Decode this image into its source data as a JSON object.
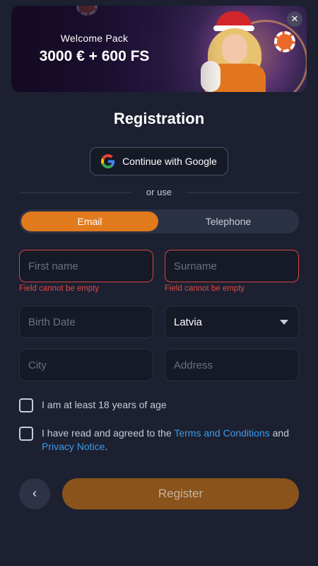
{
  "banner": {
    "subtitle": "Welcome Pack",
    "title": "3000 € + 600 FS",
    "close_glyph": "✕"
  },
  "page_title": "Registration",
  "google": {
    "label": "Continue with Google",
    "icon": "google-icon"
  },
  "divider_text": "or use",
  "tabs": [
    {
      "label": "Email",
      "active": true
    },
    {
      "label": "Telephone",
      "active": false
    }
  ],
  "fields": {
    "first_name": {
      "placeholder": "First name",
      "error": "Field cannot be empty"
    },
    "surname": {
      "placeholder": "Surname",
      "error": "Field cannot be empty"
    },
    "birth_date": {
      "placeholder": "Birth Date"
    },
    "country": {
      "value": "Latvia"
    },
    "city": {
      "placeholder": "City"
    },
    "address": {
      "placeholder": "Address"
    }
  },
  "checks": {
    "age": "I am at least 18 years of age",
    "terms_prefix": "I have read and agreed to the ",
    "terms_link": "Terms and Conditions",
    "terms_mid": " and",
    "privacy_link": "Privacy Notice",
    "terms_suffix": "."
  },
  "actions": {
    "back_glyph": "‹",
    "register": "Register"
  },
  "colors": {
    "accent": "#e07a1c",
    "error": "#e04848",
    "link": "#3d9be9",
    "background": "#1c2030"
  }
}
